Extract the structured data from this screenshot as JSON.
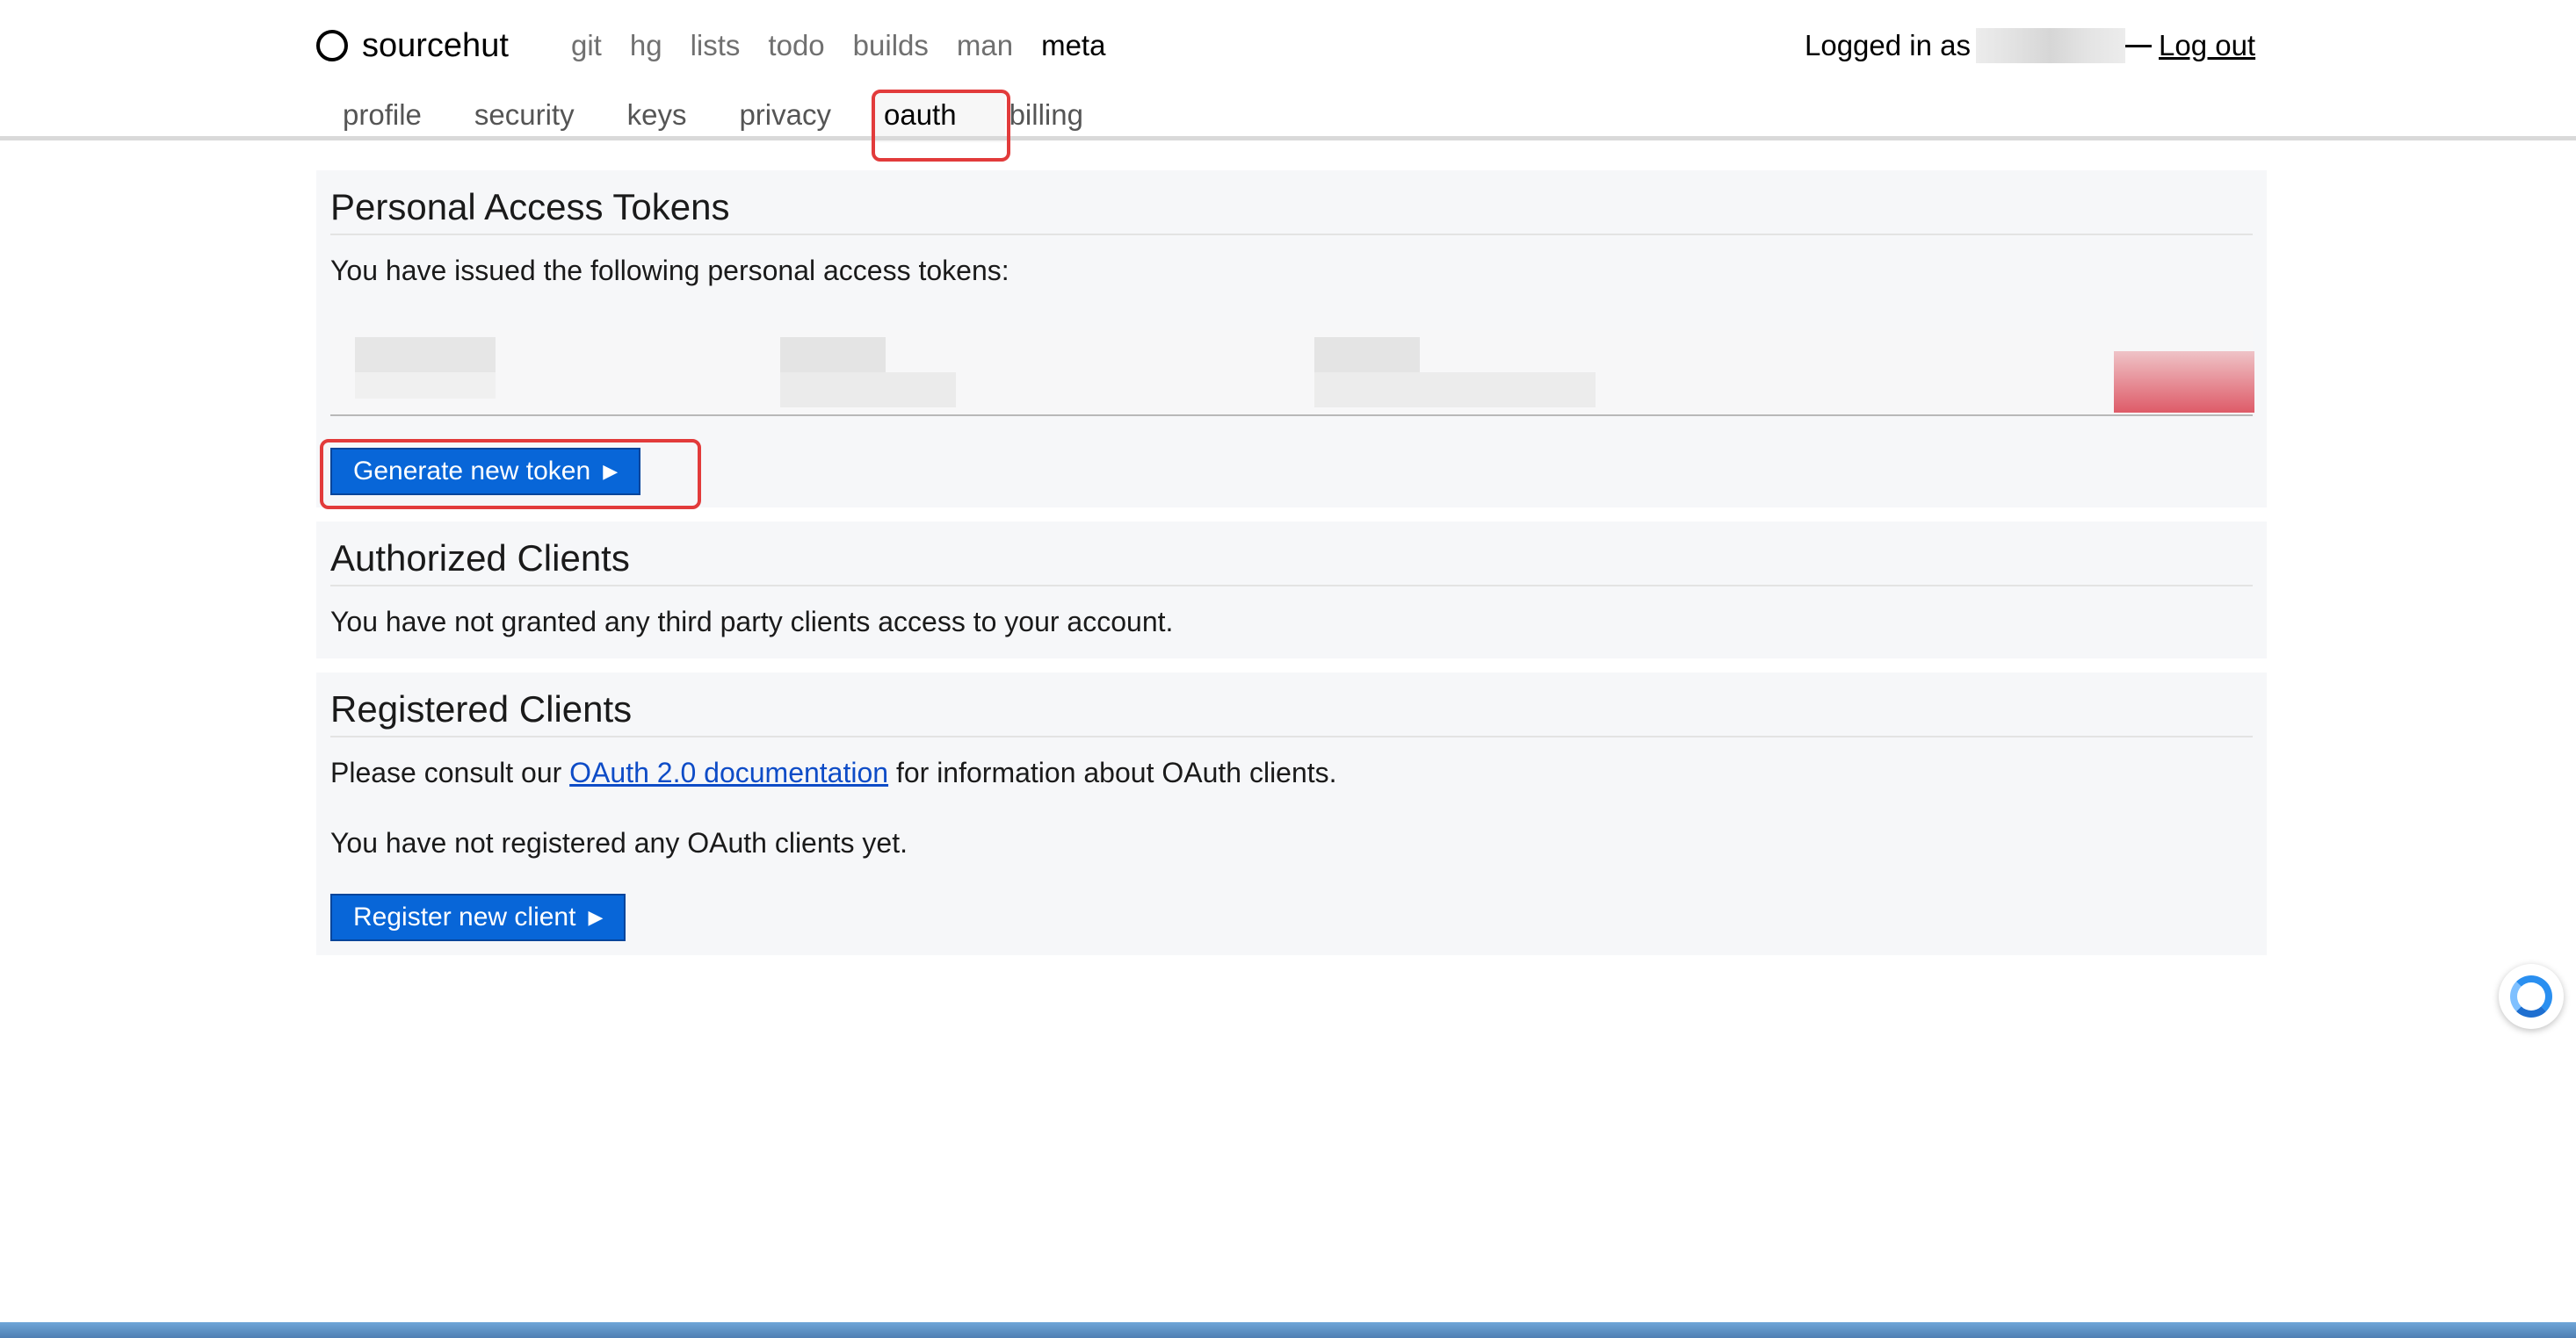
{
  "brand": {
    "name": "sourcehut"
  },
  "services": [
    "git",
    "hg",
    "lists",
    "todo",
    "builds",
    "man",
    "meta"
  ],
  "active_service": "meta",
  "login": {
    "text": "Logged in as",
    "logout": "Log out"
  },
  "subnav": [
    "profile",
    "security",
    "keys",
    "privacy",
    "oauth",
    "billing"
  ],
  "active_tab": "oauth",
  "personal_tokens": {
    "title": "Personal Access Tokens",
    "description": "You have issued the following personal access tokens:",
    "button": "Generate new token"
  },
  "authorized_clients": {
    "title": "Authorized Clients",
    "description": "You have not granted any third party clients access to your account."
  },
  "registered_clients": {
    "title": "Registered Clients",
    "consult_prefix": "Please consult our",
    "consult_link": "OAuth 2.0 documentation",
    "consult_suffix": "for information about OAuth clients.",
    "none_text": "You have not registered any OAuth clients yet.",
    "button": "Register new client"
  },
  "colors": {
    "button": "#0866d8",
    "highlight": "#e23b3b",
    "link": "#0e4cc7"
  },
  "icons": {
    "logo": "circle-logo-icon",
    "caret": "caret-right-icon",
    "assistant": "assistant-orb-icon"
  }
}
